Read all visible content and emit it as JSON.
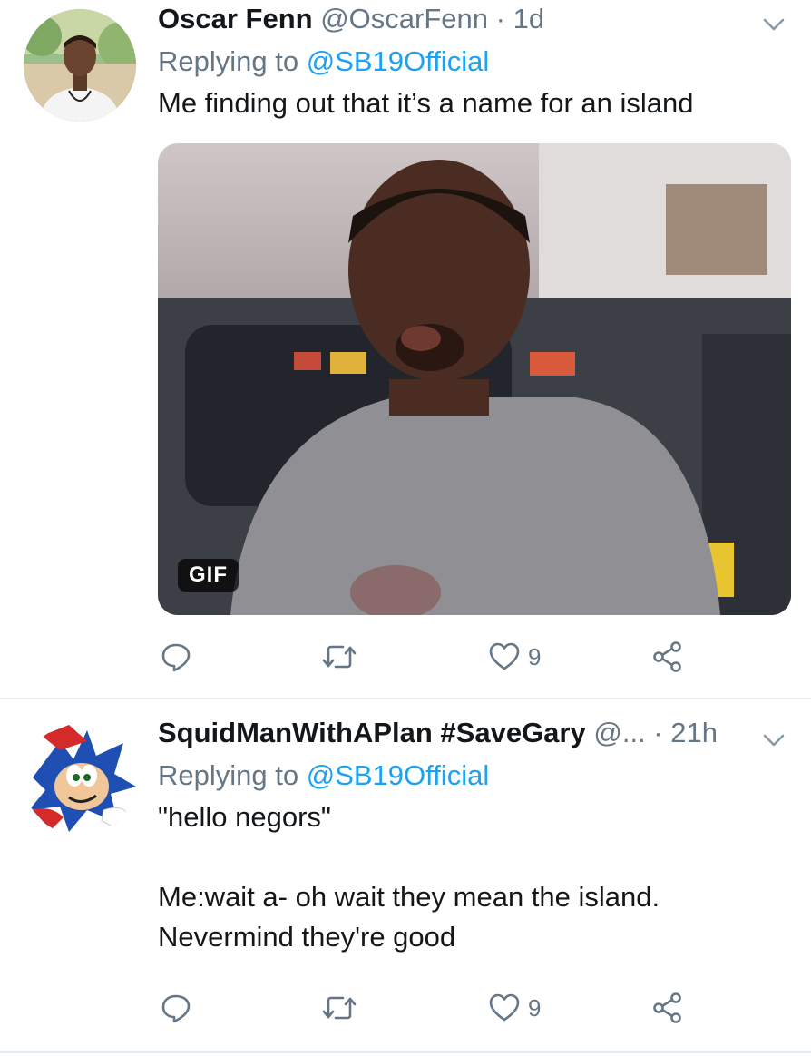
{
  "tweets": [
    {
      "display_name": "Oscar Fenn",
      "handle": "@OscarFenn",
      "separator": "·",
      "time": "1d",
      "replying_prefix": "Replying to",
      "replying_handle": "@SB19Official",
      "text": "Me finding out that it’s a name for an island",
      "media_badge": "GIF",
      "actions": {
        "reply_icon": "reply-icon",
        "retweet_icon": "retweet-icon",
        "like_icon": "heart-icon",
        "like_count": "9",
        "share_icon": "share-icon"
      }
    },
    {
      "display_name": "SquidManWithAPlan #SaveGary",
      "handle": "@...",
      "separator": "·",
      "time": "21h",
      "replying_prefix": "Replying to",
      "replying_handle": "@SB19Official",
      "text": "\"hello negors\"\n\nMe:wait a- oh wait they mean the island.\nNevermind they're good",
      "actions": {
        "reply_icon": "reply-icon",
        "retweet_icon": "retweet-icon",
        "like_icon": "heart-icon",
        "like_count": "9",
        "share_icon": "share-icon"
      }
    }
  ],
  "colors": {
    "link": "#1da1f2",
    "muted": "#657786",
    "text": "#14171a",
    "divider": "#e6ecf0"
  }
}
